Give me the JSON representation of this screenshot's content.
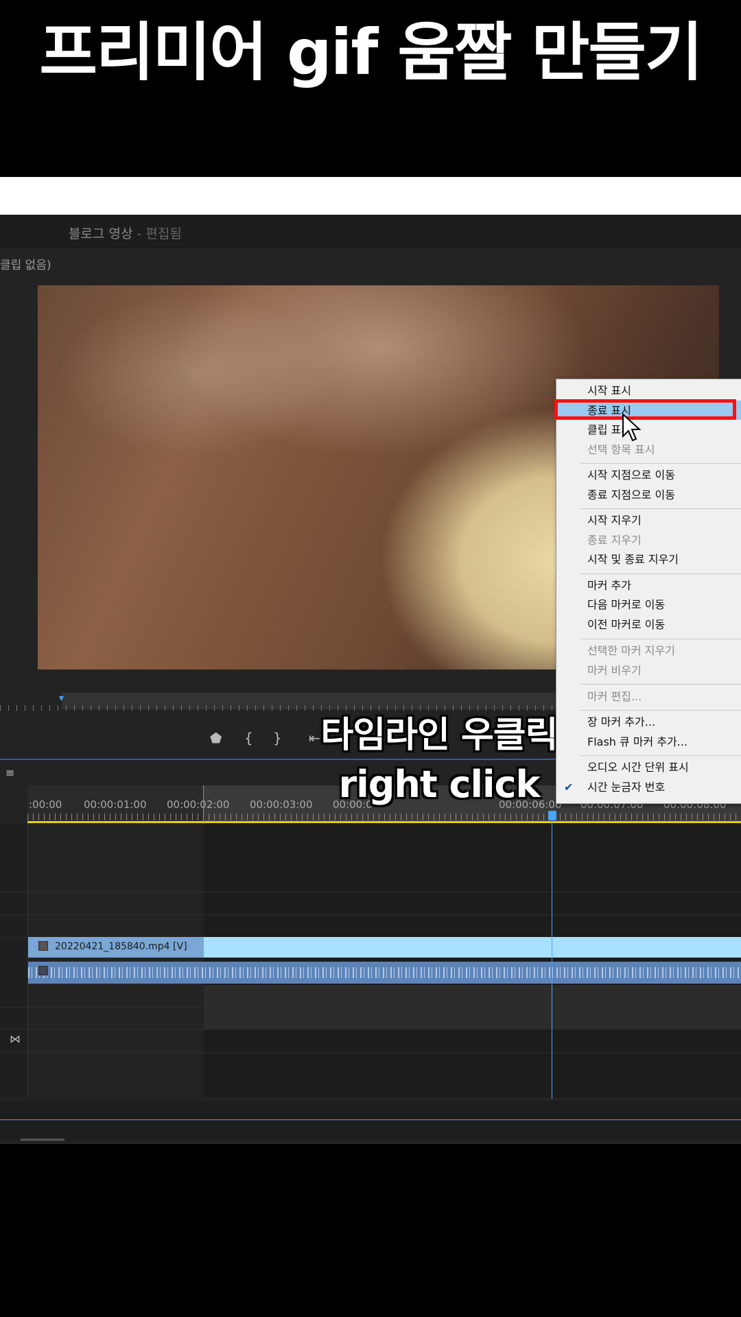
{
  "title": "프리미어 gif 움짤 만들기",
  "program_panel": {
    "title": "블로그 영상",
    "title_suffix": " - 편집됨",
    "source_label": "클립 없음)"
  },
  "captions": {
    "line1": "타임라인 우클릭",
    "line2": "right click"
  },
  "timeline": {
    "timecodes": [
      ":00:00",
      "00:00:01:00",
      "00:00:02:00",
      "00:00:03:00",
      "00:00:0",
      "00:00:06:00",
      "00:00:07:00",
      "00:00:08:00"
    ],
    "video_clip_label": "20220421_185840.mp4 [V]"
  },
  "context_menu": {
    "items": [
      {
        "label": "시작 표시",
        "enabled": true
      },
      {
        "label": "종료 표시",
        "enabled": true,
        "highlighted": true
      },
      {
        "label": "클립 표시",
        "enabled": true
      },
      {
        "label": "선택 항목 표시",
        "enabled": false
      },
      {
        "label": "시작 지점으로 이동",
        "enabled": true
      },
      {
        "label": "종료 지점으로 이동",
        "enabled": true
      },
      {
        "label": "시작 지우기",
        "enabled": true
      },
      {
        "label": "종료 지우기",
        "enabled": false
      },
      {
        "label": "시작 및 종료 지우기",
        "enabled": true
      },
      {
        "label": "마커 추가",
        "enabled": true
      },
      {
        "label": "다음 마커로 이동",
        "enabled": true
      },
      {
        "label": "이전 마커로 이동",
        "enabled": true
      },
      {
        "label": "선택한 마커 지우기",
        "enabled": false
      },
      {
        "label": "마커 비우기",
        "enabled": false
      },
      {
        "label": "마커 편집...",
        "enabled": false
      },
      {
        "label": "장 마커 추가...",
        "enabled": true
      },
      {
        "label": "Flash 큐 마커 추가...",
        "enabled": true
      },
      {
        "label": "오디오 시간 단위 표시",
        "enabled": true
      },
      {
        "label": "시간 눈금자 번호",
        "enabled": true,
        "checked": true
      }
    ]
  },
  "colors": {
    "highlight": "#99c9ef",
    "callout_border": "#ff1010",
    "playhead": "#4aa3ff",
    "video_clip": "#a8e0ff"
  }
}
